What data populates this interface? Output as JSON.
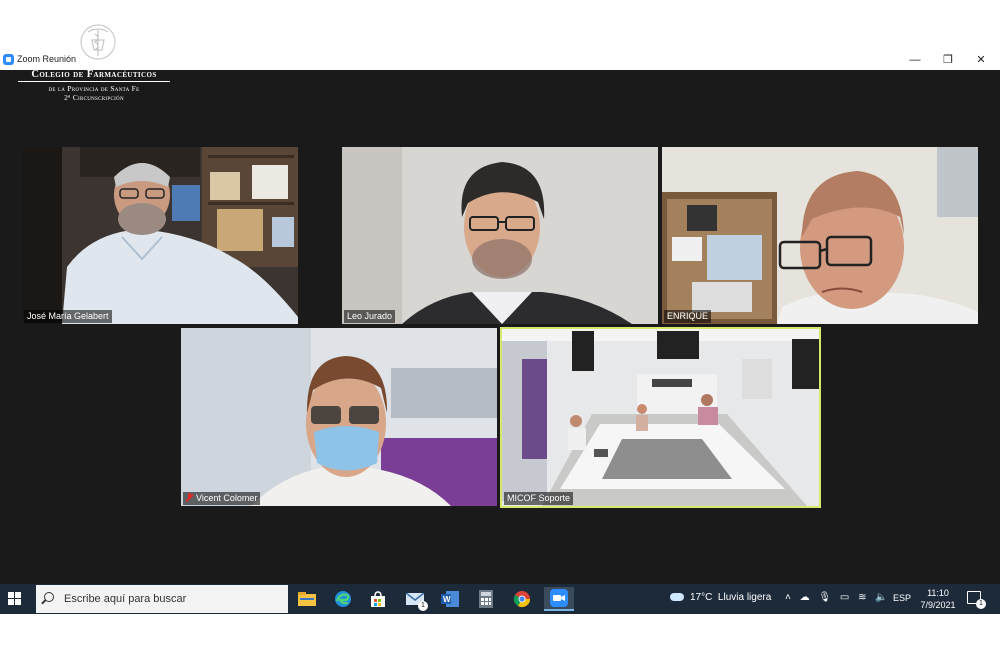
{
  "window": {
    "title": "Zoom Reunión",
    "controls": {
      "minimize": "—",
      "maximize": "❐",
      "close": "✕"
    }
  },
  "logo": {
    "line1": "Colegio de Farmacéuticos",
    "line2": "de la Provincia de Santa Fe",
    "line3": "2ª Circunscripción"
  },
  "participants": [
    {
      "name": "José María Gelabert",
      "muted": false
    },
    {
      "name": "Leo Jurado",
      "muted": false
    },
    {
      "name": "ENRIQUE",
      "muted": false
    },
    {
      "name": "Vicent Colomer",
      "muted": true
    },
    {
      "name": "MICOF Soporte",
      "muted": false,
      "active_speaker": true
    }
  ],
  "taskbar": {
    "search_placeholder": "Escribe aquí para buscar",
    "apps": [
      {
        "icon": "file-explorer-icon"
      },
      {
        "icon": "edge-icon"
      },
      {
        "icon": "store-icon"
      },
      {
        "icon": "mail-icon",
        "badge": "1"
      },
      {
        "icon": "word-icon"
      },
      {
        "icon": "calculator-icon"
      },
      {
        "icon": "chrome-icon"
      },
      {
        "icon": "zoom-icon",
        "active": true
      }
    ],
    "weather": {
      "temp": "17°C",
      "desc": "Lluvia ligera"
    },
    "language": "ESP",
    "time": "11:10",
    "date": "7/9/2021",
    "notification_badge": "1"
  },
  "colors": {
    "meeting_bg": "#1a1a1a",
    "active_speaker_border": "#d8e86a",
    "taskbar_bg": "#1c2a3a",
    "zoom_blue": "#2d8cff"
  }
}
